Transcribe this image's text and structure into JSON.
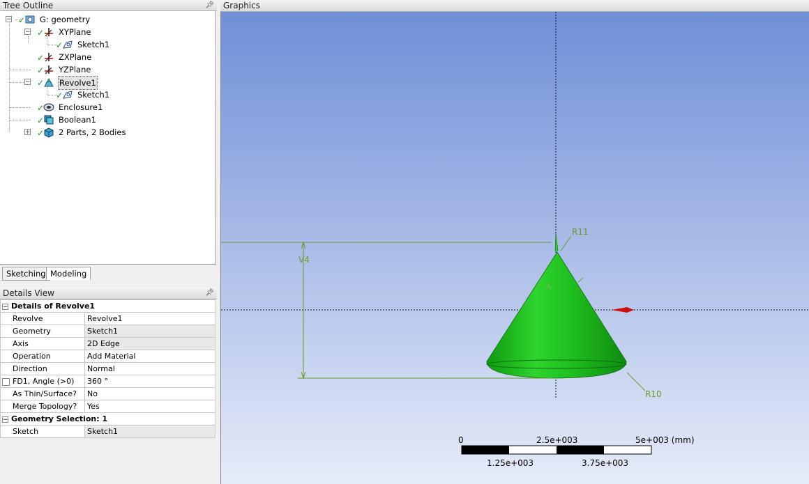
{
  "tree_outline": {
    "title": "Tree Outline",
    "items": [
      {
        "label": "G: geometry",
        "icon": "geometry-icon"
      },
      {
        "label": "XYPlane",
        "icon": "plane-axes-icon"
      },
      {
        "label": "Sketch1",
        "icon": "sketch-icon"
      },
      {
        "label": "ZXPlane",
        "icon": "plane-axes-icon"
      },
      {
        "label": "YZPlane",
        "icon": "plane-axes-icon"
      },
      {
        "label": "Revolve1",
        "icon": "revolve-icon"
      },
      {
        "label": "Sketch1",
        "icon": "sketch-icon"
      },
      {
        "label": "Enclosure1",
        "icon": "enclosure-icon"
      },
      {
        "label": "Boolean1",
        "icon": "boolean-icon"
      },
      {
        "label": "2 Parts, 2 Bodies",
        "icon": "bodies-icon"
      }
    ]
  },
  "tabs": [
    "Sketching",
    "Modeling"
  ],
  "details_view": {
    "title": "Details View",
    "section_title": "Details of Revolve1",
    "rows": [
      {
        "key": "Revolve",
        "value": "Revolve1"
      },
      {
        "key": "Geometry",
        "value": "Sketch1"
      },
      {
        "key": "Axis",
        "value": "2D Edge"
      },
      {
        "key": "Operation",
        "value": "Add Material"
      },
      {
        "key": "Direction",
        "value": "Normal"
      },
      {
        "key": "FD1,  Angle (>0)",
        "value": "360 °"
      },
      {
        "key": "As Thin/Surface?",
        "value": "No"
      },
      {
        "key": "Merge Topology?",
        "value": "Yes"
      }
    ],
    "section2_title": "Geometry Selection: 1",
    "rows2": [
      {
        "key": "Sketch",
        "value": "Sketch1"
      }
    ]
  },
  "graphics": {
    "title": "Graphics",
    "dim_v4": "V4",
    "dim_r11": "R11",
    "dim_r10": "R10",
    "dim_a": "A",
    "scale": {
      "top_labels": [
        "0",
        "2.5e+003",
        "5e+003 (mm)"
      ],
      "bottom_labels": [
        "1.25e+003",
        "3.75e+003"
      ]
    },
    "colors": {
      "body": "#1fbf1f",
      "background_top": "#6f8fd8",
      "background_bottom": "#e6ebf8",
      "dimension": "#6a9a2a"
    }
  }
}
